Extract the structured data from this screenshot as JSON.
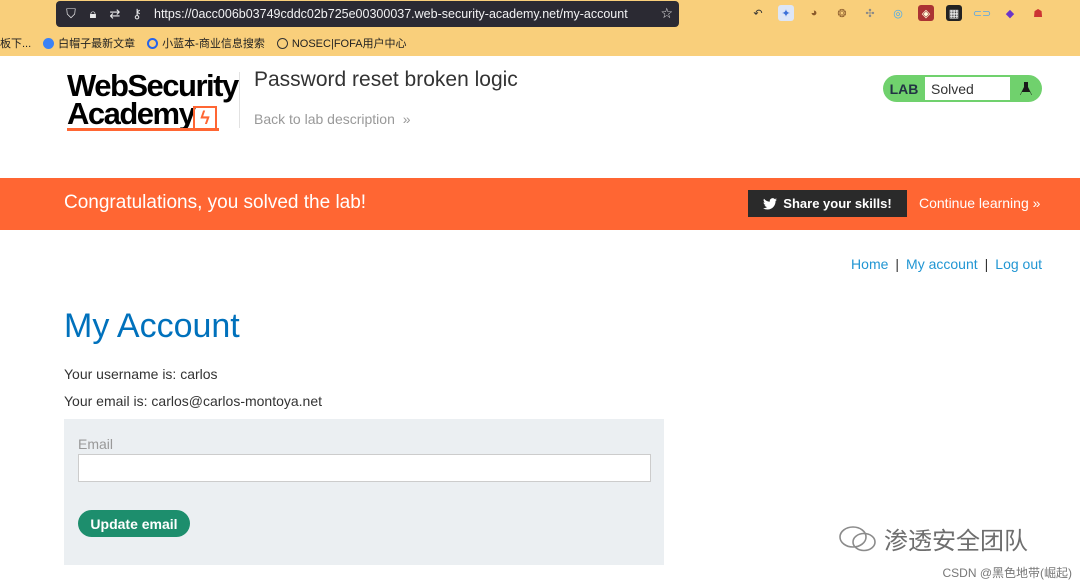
{
  "browser": {
    "url": "https://0acc006b03749cddc02b725e00300037.web-security-academy.net/my-account",
    "bookmarks": [
      "板下...",
      "白帽子最新文章",
      "小蓝本-商业信息搜索",
      "NOSEC|FOFA用户中心"
    ]
  },
  "header": {
    "logo_line1": "WebSecurity",
    "logo_line2": "Academy",
    "lab_title": "Password reset broken logic",
    "back_link": "Back to lab description",
    "lab_badge": "LAB",
    "lab_status": "Solved"
  },
  "banner": {
    "message": "Congratulations, you solved the lab!",
    "share_label": "Share your skills!",
    "continue_label": "Continue learning"
  },
  "nav": {
    "home": "Home",
    "sep": "|",
    "my_account": "My account",
    "log_out": "Log out"
  },
  "account": {
    "title": "My Account",
    "username_line": "Your username is: carlos",
    "email_line": "Your email is: carlos@carlos-montoya.net",
    "email_label": "Email",
    "email_value": "",
    "update_label": "Update email"
  },
  "watermark": {
    "text": "渗透安全团队",
    "csdn": "CSDN @黑色地带(崛起)"
  },
  "colors": {
    "brand_orange": "#ff6633",
    "link_blue": "#2196d3",
    "title_blue": "#0071bc",
    "solved_green": "#70d16d",
    "button_green": "#1d8e6d"
  }
}
